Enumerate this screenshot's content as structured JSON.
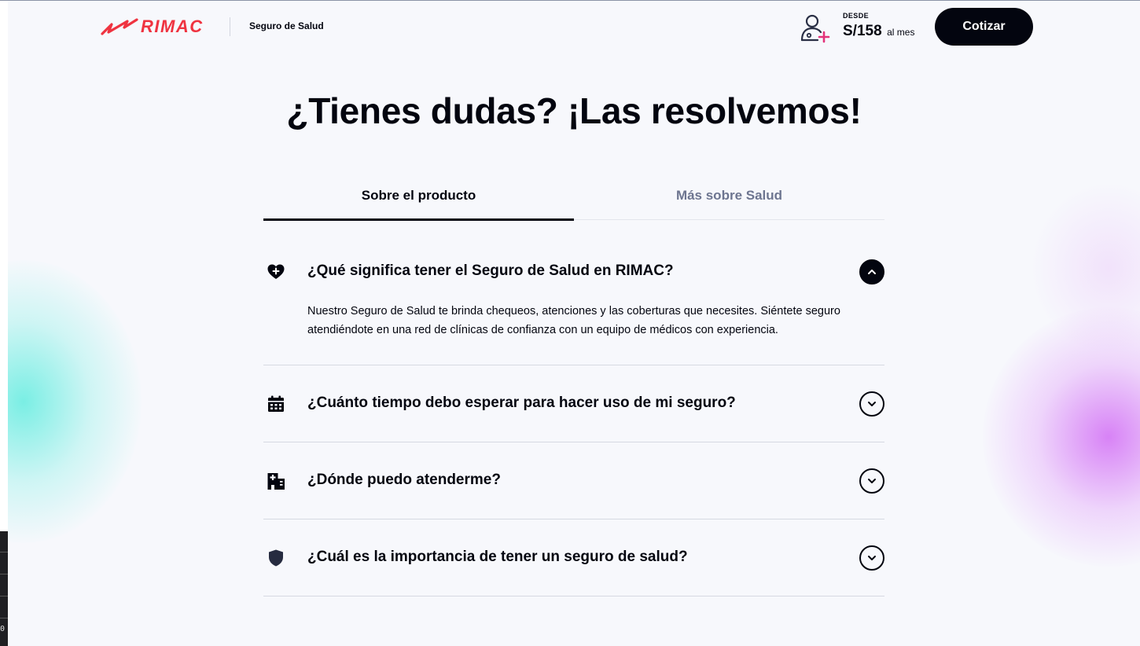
{
  "header": {
    "brand": "RIMAC",
    "product": "Seguro de Salud",
    "price_label": "DESDE",
    "price_amount": "S/158",
    "price_unit": "al mes",
    "cta_label": "Cotizar"
  },
  "title": "¿Tienes dudas? ¡Las resolvemos!",
  "tabs": [
    {
      "label": "Sobre el producto",
      "active": true
    },
    {
      "label": "Más sobre Salud",
      "active": false
    }
  ],
  "faq": [
    {
      "icon": "heart-plus-icon",
      "question": "¿Qué significa tener el Seguro de Salud en RIMAC?",
      "expanded": true,
      "answer": "Nuestro Seguro de Salud te brinda chequeos, atenciones y las coberturas que necesites. Siéntete seguro atendiéndote en una red de clínicas de confianza con un equipo de médicos con experiencia."
    },
    {
      "icon": "calendar-icon",
      "question": "¿Cuánto tiempo debo esperar para hacer uso de mi seguro?",
      "expanded": false
    },
    {
      "icon": "hospital-icon",
      "question": "¿Dónde puedo atenderme?",
      "expanded": false
    },
    {
      "icon": "shield-icon",
      "question": "¿Cuál es la importancia de tener un seguro de salud?",
      "expanded": false
    }
  ],
  "colors": {
    "brand_red": "#ef3340",
    "ink": "#03050f",
    "muted": "#6d7590"
  },
  "edge_glyph": "0"
}
